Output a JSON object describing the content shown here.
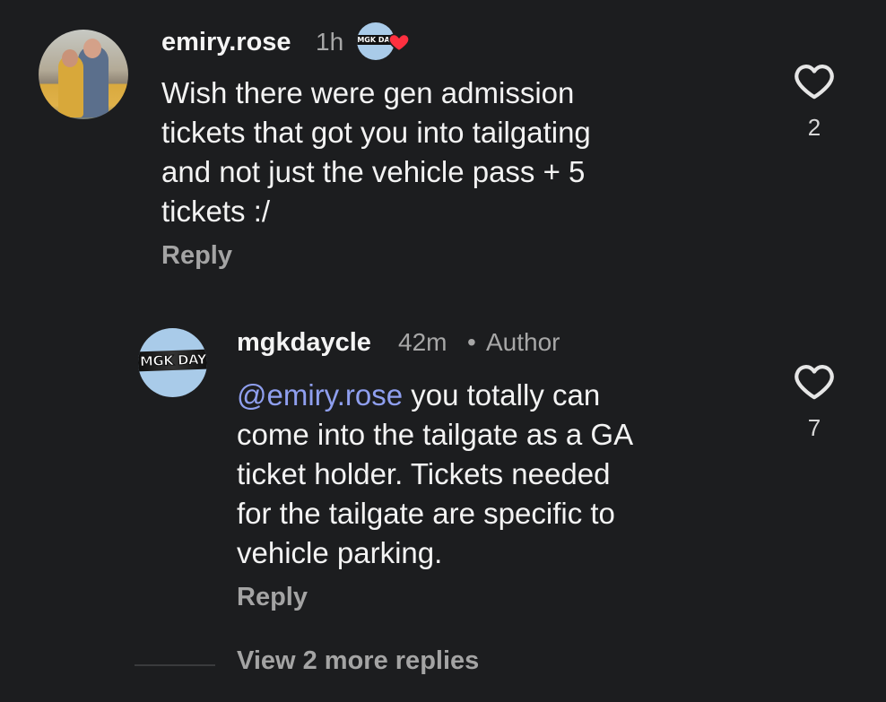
{
  "comments": [
    {
      "username": "emiry.rose",
      "time": "1h",
      "text": "Wish there were gen admission\ntickets that got you into tailgating\nand not just the vehicle pass + 5\ntickets :/",
      "reply_label": "Reply",
      "likes": "2",
      "avatar_icon": "profile-photo"
    },
    {
      "username": "mgkdaycle",
      "time": "42m",
      "separator": "•",
      "role": "Author",
      "avatar_logo_text": "MGK DAY",
      "mention": "@emiry.rose",
      "text": " you totally can\ncome into the tailgate as a GA\nticket holder. Tickets needed\nfor the tailgate are specific to\nvehicle parking.",
      "reply_label": "Reply",
      "likes": "7"
    }
  ],
  "badge": {
    "logo_text": "MGK DAY",
    "icon": "liked-by-author-heart-icon",
    "heart_color": "#ff3040"
  },
  "view_more_label": "View 2 more replies",
  "colors": {
    "background": "#1c1d1f",
    "mention": "#8f9fef",
    "muted": "#a7a7a7",
    "logo_bg": "#a9cbe9"
  }
}
